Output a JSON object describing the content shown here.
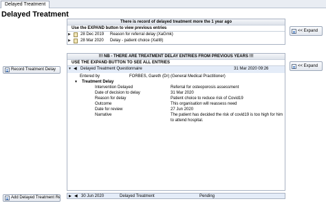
{
  "tab": {
    "label": "Delayed Treatment"
  },
  "page_title": "Delayed Treatment",
  "previous_year_panel": {
    "header": "There is record of delayed treatment more the 1 year ago",
    "subheader": "Use the EXPAND button to view previous entries",
    "rows": [
      {
        "date": "28 Dec 2019",
        "description": "Reason for referral delay (XaGmk)"
      },
      {
        "date": "28 Mar 2020",
        "description": "Delay - patient choice (XaII8)"
      }
    ]
  },
  "entries_panel": {
    "header": "!!! NB - THERE ARE TREATMENT DELAY ENTRIES FROM PREVIOUS YEARS !!!",
    "subheader": "USE THE EXPAND BUTTON TO SEE ALL ENTRIES",
    "questionnaire": {
      "title": "Delayed Treatment Questionnaire",
      "datetime": "31 Mar 2020 09:26",
      "entered_by_label": "Entered by",
      "entered_by_value": "FORBES, Gareth (Dr) (General Medical Practitioner)",
      "section_title": "Treatment Delay",
      "fields": [
        {
          "label": "Intervention Delayed",
          "value": "Referral for osteoporosis assessment"
        },
        {
          "label": "Date of decision to delay",
          "value": "31 Mar 2020"
        },
        {
          "label": "Reason for delay",
          "value": "Patient choice to reduce risk of Covid19"
        },
        {
          "label": "Outcome",
          "value": "This organisation will reassess need"
        },
        {
          "label": "Date for review",
          "value": "27 Jun 2020"
        },
        {
          "label": "Narrative",
          "value": "The patient has decided the risk of covid19 is too high for him",
          "value2": "to attend hospital."
        }
      ]
    }
  },
  "bottom_row": {
    "date": "30 Jun 2020",
    "name": "Delayed Treatment",
    "status": "Pending"
  },
  "buttons": {
    "expand_1": "<< Expand",
    "expand_2": "<< Expand",
    "record": "Record Treatment Delay",
    "add_recall": "Add Delayed Treatment Recall"
  }
}
